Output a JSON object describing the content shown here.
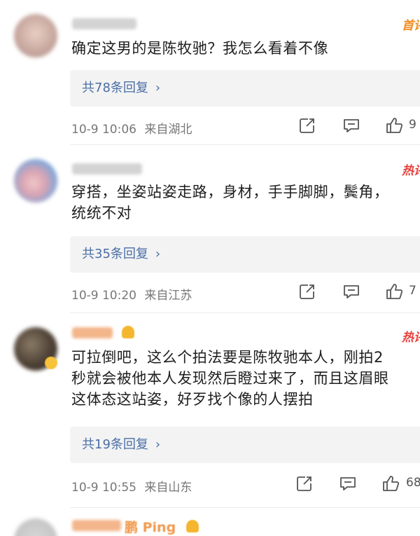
{
  "comments": [
    {
      "tag": "首评",
      "tag_color": "#f08b1f",
      "text_lines": [
        "确定这男的是陈牧驰？我怎么看着不像"
      ],
      "replies": "共78条回复",
      "time": "10-9 10:06",
      "location": "来自湖北",
      "likes": "9"
    },
    {
      "tag": "热评",
      "tag_color": "#e8403c",
      "text_lines": [
        "穿搭，坐姿站姿走路，身材，手手脚脚，鬓角，",
        "统统不对"
      ],
      "replies": "共35条回复",
      "time": "10-9 10:20",
      "location": "来自江苏",
      "likes": "7"
    },
    {
      "tag": "热评",
      "tag_color": "#e8403c",
      "text_lines": [
        "可拉倒吧，这么个拍法要是陈牧驰本人，刚拍2",
        "秒就会被他本人发现然后瞪过来了，而且这眉眼",
        "这体态这站姿，好歹找个像的人摆拍"
      ],
      "replies": "共19条回复",
      "time": "10-9 10:55",
      "location": "来自山东",
      "likes": "68"
    }
  ],
  "next_comment": {
    "name_partial": "鹏 Ping"
  },
  "icons": {
    "forward": "share-icon",
    "comment": "comment-icon",
    "like": "like-icon",
    "chevron": "chevron-right-icon"
  }
}
